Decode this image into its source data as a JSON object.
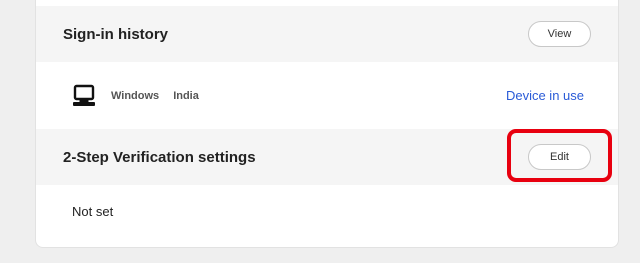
{
  "sign_in_history": {
    "title": "Sign-in history",
    "view_label": "View",
    "device": {
      "icon": "laptop-icon",
      "os": "Windows",
      "location": "India",
      "status": "Device in use"
    }
  },
  "two_step": {
    "title": "2-Step Verification settings",
    "edit_label": "Edit",
    "value": "Not set",
    "highlight_color": "#e8000f"
  },
  "colors": {
    "link": "#2a5bd7",
    "header_bg": "#f5f5f5",
    "page_bg": "#efefef"
  }
}
